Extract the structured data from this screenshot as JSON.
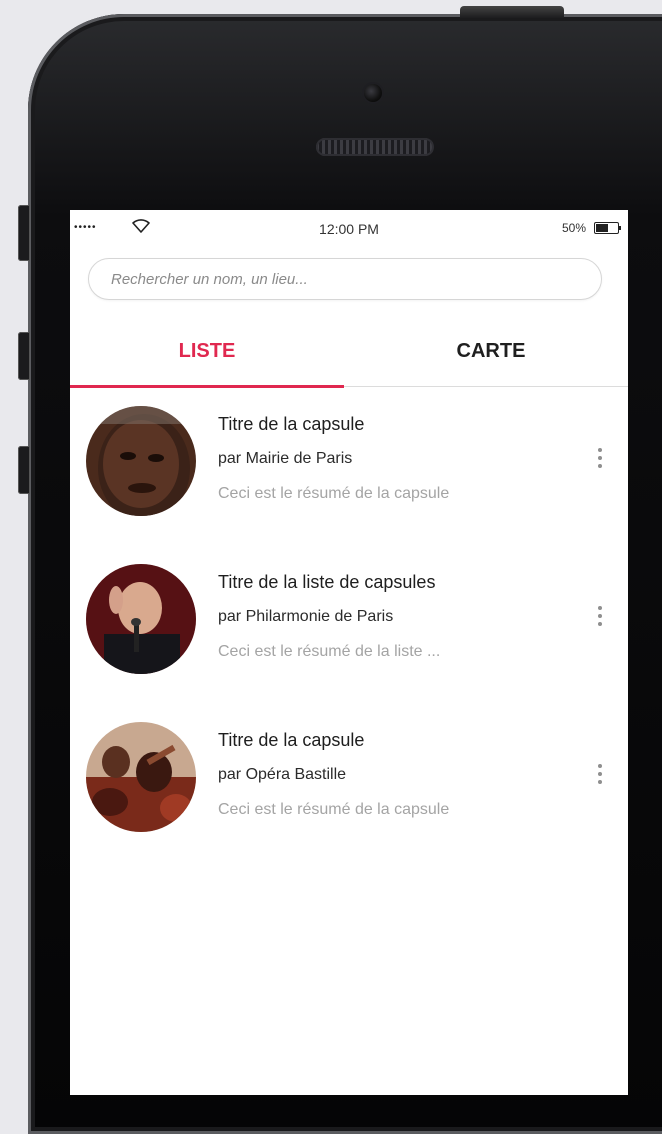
{
  "status_bar": {
    "signal": "•••••",
    "time": "12:00 PM",
    "battery": "50%"
  },
  "search": {
    "placeholder": "Rechercher un nom, un lieu..."
  },
  "tabs": [
    {
      "label": "LISTE",
      "active": true
    },
    {
      "label": "CARTE",
      "active": false
    }
  ],
  "colors": {
    "accent": "#e0284f",
    "text": "#1e1e1e",
    "muted": "#a4a4a4"
  },
  "items": [
    {
      "title": "Titre de la capsule",
      "author": "par Mairie de Paris",
      "summary": "Ceci est le résumé de la capsule"
    },
    {
      "title": "Titre de la liste de capsules",
      "author": "par Philarmonie de Paris",
      "summary": "Ceci est le résumé de la liste ..."
    },
    {
      "title": "Titre de la capsule",
      "author": "par Opéra Bastille",
      "summary": "Ceci est le résumé de la capsule"
    }
  ],
  "icons": {
    "wifi": "wifi-icon",
    "battery": "battery-icon",
    "more": "more-vertical-icon"
  }
}
